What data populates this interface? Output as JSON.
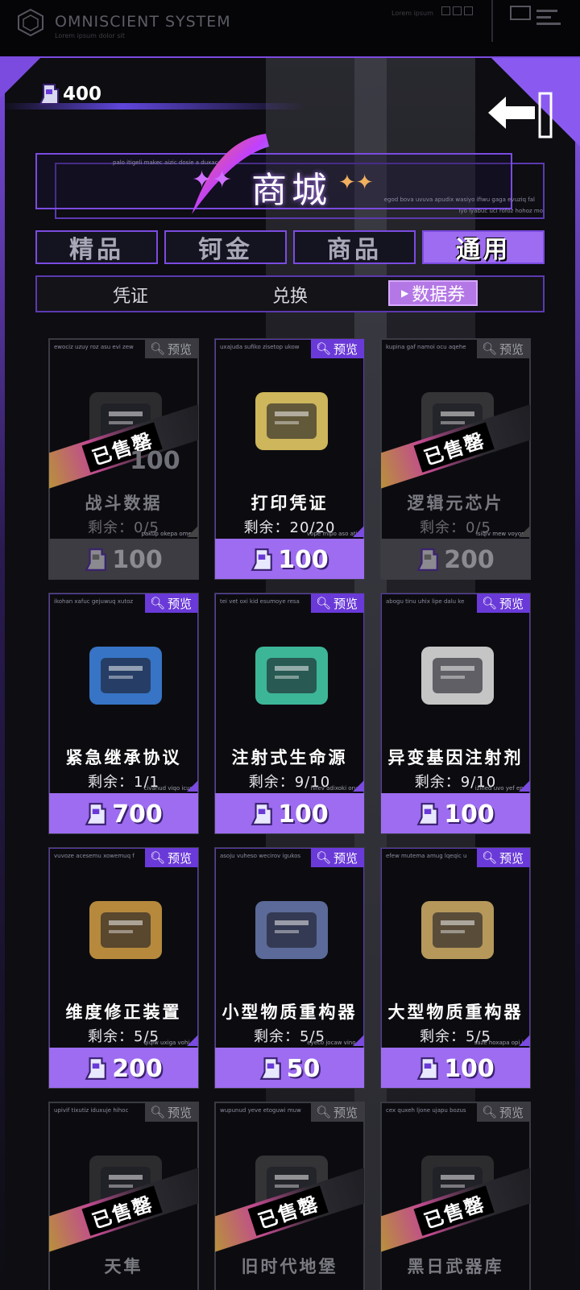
{
  "system": {
    "name": "OMNISCIENT SYSTEM",
    "subtitle": "Lorem ipsum dolor sit",
    "lorem": "Lorem ipsum"
  },
  "currency": {
    "amount": "400",
    "icon": "ticket-icon"
  },
  "title": {
    "label": "商城",
    "tiny_top": "palo itigeli makec aizic dosie a duxace ura",
    "tiny_right": "egod bova uvuva apudix wasiyo ifiwu gaga evuziq fal",
    "tiny_right2": "iyo lyabuc uci rofoz hohoz mo"
  },
  "tabs": [
    {
      "label": "精品",
      "active": false
    },
    {
      "label": "钶金",
      "active": false
    },
    {
      "label": "商品",
      "active": false
    },
    {
      "label": "通用",
      "active": true
    }
  ],
  "subtabs": [
    {
      "label": "凭证",
      "active": false
    },
    {
      "label": "兑换",
      "active": false
    },
    {
      "label": "数据券",
      "active": true
    }
  ],
  "preview_label": "预览",
  "sold_label": "已售罄",
  "cards": [
    {
      "hdr": "ewociz uzuy roz asu evi zew",
      "name": "战斗数据",
      "remain": "剩余：0/5",
      "ftr": "pakup okepa omev",
      "price": "100",
      "sold": true,
      "sold_num": "100"
    },
    {
      "hdr": "uxajuda sufiko zisetop ukow",
      "name": "打印凭证",
      "remain": "剩余：20/20",
      "ftr": "vope mipo aso atin",
      "price": "100",
      "sold": false
    },
    {
      "hdr": "kupina gaf namoi ocu aqehe",
      "name": "逻辑元芯片",
      "remain": "剩余：0/5",
      "ftr": "isiqiv mew voyom",
      "price": "200",
      "sold": true
    },
    {
      "hdr": "ikohan xafuc gejuwuq xutoz",
      "name": "紧急继承协议",
      "remain": "剩余：1/1",
      "ftr": "civanud viqo icuni",
      "price": "700",
      "sold": false
    },
    {
      "hdr": "tei vet oxi kid esumoye resa",
      "name": "注射式生命源",
      "remain": "剩余：9/10",
      "ftr": "hifev adixoki oruv",
      "price": "100",
      "sold": false
    },
    {
      "hdr": "abogu tinu uhix lipe dalu ke",
      "name": "异变基因注射剂",
      "remain": "剩余：9/10",
      "ftr": "izined uvo yef epa",
      "price": "100",
      "sold": false
    },
    {
      "hdr": "vuvoze acesemu xowemuq f",
      "name": "维度修正装置",
      "remain": "剩余：5/5",
      "ftr": "qiqiw uxiga vohi q",
      "price": "200",
      "sold": false
    },
    {
      "hdr": "asoju vuheso wecirov igukos",
      "name": "小型物质重构器",
      "remain": "剩余：5/5",
      "ftr": "eyeco jocaw vino a",
      "price": "50",
      "sold": false
    },
    {
      "hdr": "efew mutema amug lqeqic u",
      "name": "大型物质重构器",
      "remain": "剩余：5/5",
      "ftr": "saze hoxapa opi ju",
      "price": "100",
      "sold": false
    },
    {
      "hdr": "upivif tixutiz iduxuje hihoc",
      "name": "天隼",
      "remain": "",
      "ftr": "",
      "price": "",
      "sold": true
    },
    {
      "hdr": "wupunud yeve etoguwi muw",
      "name": "旧时代地堡",
      "remain": "",
      "ftr": "",
      "price": "",
      "sold": true
    },
    {
      "hdr": "cex quxeh ljone ujapu bozus",
      "name": "黑日武器库",
      "remain": "",
      "ftr": "",
      "price": "",
      "sold": true
    }
  ],
  "colors": {
    "accent": "#9d6cf0",
    "border": "#7b4be0",
    "bg": "#0d0d12"
  }
}
